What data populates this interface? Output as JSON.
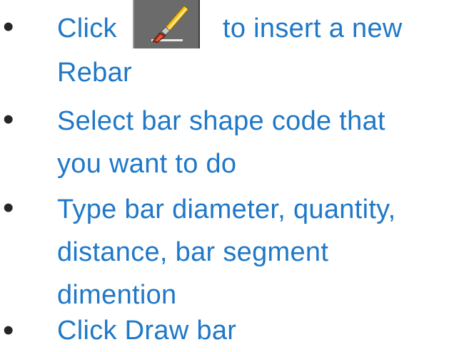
{
  "slide": {
    "bullet_char": "•",
    "items": [
      {
        "lines": [
          "Click",
          "to insert a new",
          "Rebar"
        ],
        "icon": "paintbrush-icon"
      },
      {
        "lines": [
          "Select bar shape code that",
          "you want to do"
        ]
      },
      {
        "lines": [
          "Type bar diameter, quantity,",
          "distance, bar segment",
          "dimention"
        ]
      },
      {
        "lines": [
          "Click Draw bar"
        ]
      }
    ]
  },
  "colors": {
    "text": "#1f78c8",
    "bullet": "#262626",
    "button_bg": "#6b6b6b"
  }
}
